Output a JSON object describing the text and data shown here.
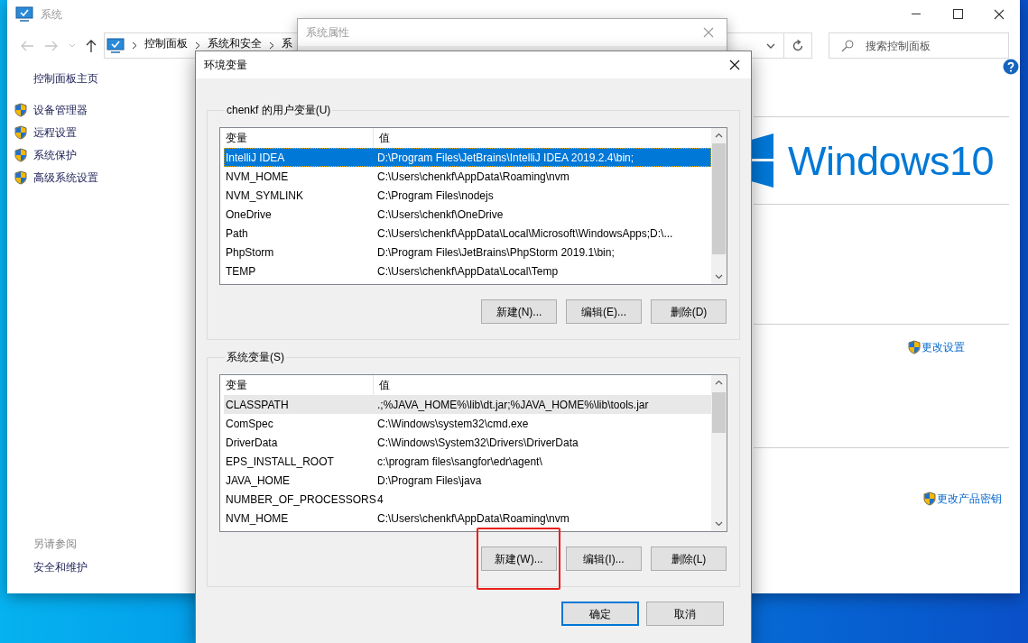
{
  "main_window": {
    "title": "系统",
    "breadcrumbs": [
      "控制面板",
      "系统和安全",
      "系"
    ],
    "search": {
      "placeholder": "搜索控制面板"
    },
    "sidebar": {
      "home": "控制面板主页",
      "items": [
        "设备管理器",
        "远程设置",
        "系统保护",
        "高级系统设置"
      ],
      "see_also_heading": "另请参阅",
      "see_also": [
        "安全和维护"
      ]
    },
    "brand": "Windows10",
    "links": [
      "更改设置",
      "更改产品密钥"
    ]
  },
  "system_properties": {
    "title": "系统属性",
    "active": false
  },
  "env_dialog": {
    "title": "环境变量",
    "user_vars": {
      "label": "chenkf 的用户变量(U)",
      "focused": true,
      "columns": [
        "变量",
        "值"
      ],
      "rows": [
        {
          "name": "IntelliJ IDEA",
          "value": "D:\\Program Files\\JetBrains\\IntelliJ IDEA 2019.2.4\\bin;",
          "selected": true
        },
        {
          "name": "NVM_HOME",
          "value": "C:\\Users\\chenkf\\AppData\\Roaming\\nvm",
          "selected": false
        },
        {
          "name": "NVM_SYMLINK",
          "value": "C:\\Program Files\\nodejs",
          "selected": false
        },
        {
          "name": "OneDrive",
          "value": "C:\\Users\\chenkf\\OneDrive",
          "selected": false
        },
        {
          "name": "Path",
          "value": "C:\\Users\\chenkf\\AppData\\Local\\Microsoft\\WindowsApps;D:\\...",
          "selected": false
        },
        {
          "name": "PhpStorm",
          "value": "D:\\Program Files\\JetBrains\\PhpStorm 2019.1\\bin;",
          "selected": false
        },
        {
          "name": "TEMP",
          "value": "C:\\Users\\chenkf\\AppData\\Local\\Temp",
          "selected": false
        }
      ],
      "buttons": [
        "新建(N)...",
        "编辑(E)...",
        "删除(D)"
      ]
    },
    "system_vars": {
      "label": "系统变量(S)",
      "focused": false,
      "columns": [
        "变量",
        "值"
      ],
      "rows": [
        {
          "name": "CLASSPATH",
          "value": ".;%JAVA_HOME%\\lib\\dt.jar;%JAVA_HOME%\\lib\\tools.jar",
          "selected": true
        },
        {
          "name": "ComSpec",
          "value": "C:\\Windows\\system32\\cmd.exe",
          "selected": false
        },
        {
          "name": "DriverData",
          "value": "C:\\Windows\\System32\\Drivers\\DriverData",
          "selected": false
        },
        {
          "name": "EPS_INSTALL_ROOT",
          "value": "c:\\program files\\sangfor\\edr\\agent\\",
          "selected": false
        },
        {
          "name": "JAVA_HOME",
          "value": "D:\\Program Files\\java",
          "selected": false
        },
        {
          "name": "NUMBER_OF_PROCESSORS",
          "value": "4",
          "selected": false
        },
        {
          "name": "NVM_HOME",
          "value": "C:\\Users\\chenkf\\AppData\\Roaming\\nvm",
          "selected": false
        }
      ],
      "buttons": [
        "新建(W)...",
        "编辑(I)...",
        "删除(L)"
      ]
    },
    "buttons": [
      {
        "label": "确定",
        "default": true
      },
      {
        "label": "取消",
        "default": false
      }
    ]
  }
}
